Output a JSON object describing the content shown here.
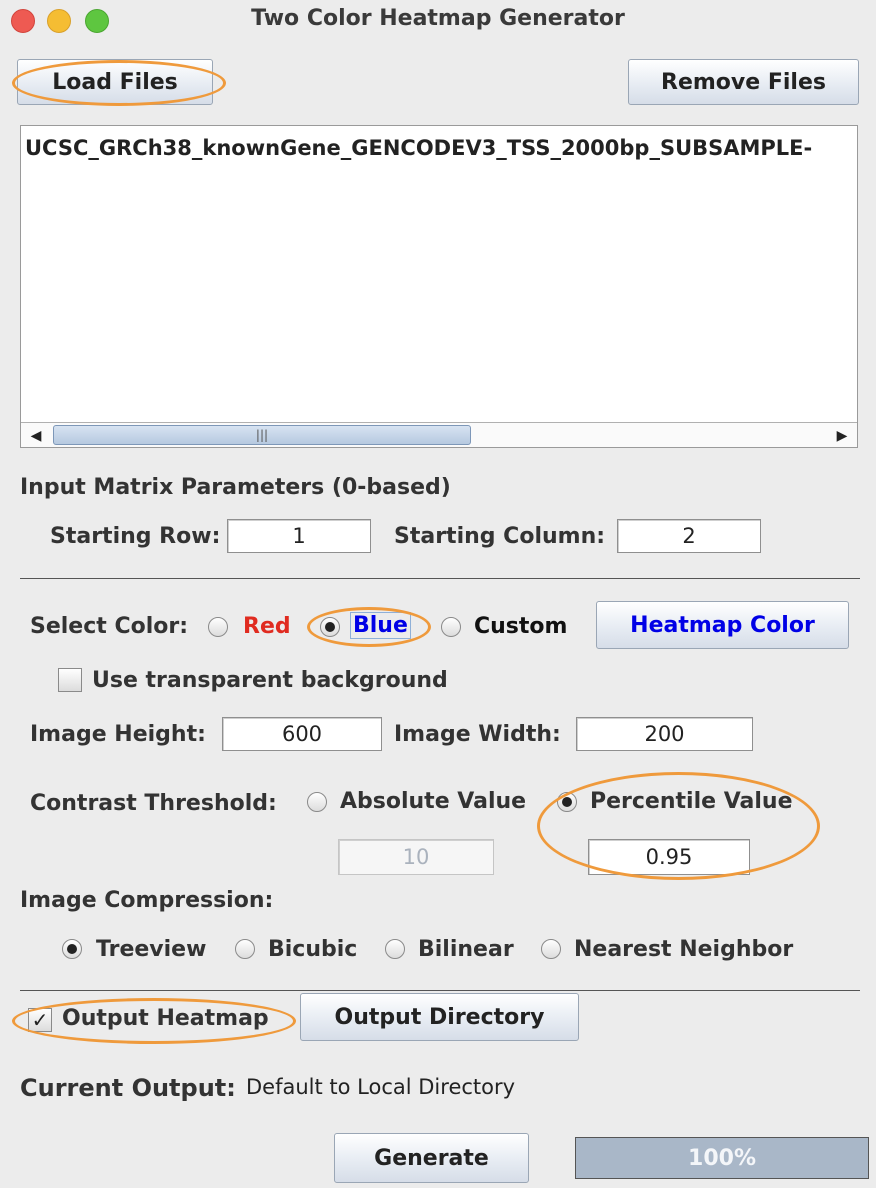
{
  "window": {
    "title": "Two Color Heatmap Generator"
  },
  "buttons": {
    "load_files": "Load Files",
    "remove_files": "Remove Files",
    "heatmap_color": "Heatmap Color",
    "output_directory": "Output Directory",
    "generate": "Generate"
  },
  "file_list": {
    "items": [
      "UCSC_GRCh38_knownGene_GENCODEV3_TSS_2000bp_SUBSAMPLE-"
    ]
  },
  "matrix": {
    "heading": "Input Matrix Parameters (0-based)",
    "starting_row_label": "Starting Row:",
    "starting_row_value": "1",
    "starting_column_label": "Starting Column:",
    "starting_column_value": "2"
  },
  "color": {
    "label": "Select Color:",
    "options": {
      "red": "Red",
      "blue": "Blue",
      "custom": "Custom"
    },
    "selected": "Blue",
    "red_color": "#e02b20",
    "blue_color": "#0000e6",
    "transparent_label": "Use transparent background",
    "transparent_checked": false
  },
  "image": {
    "height_label": "Image Height:",
    "height_value": "600",
    "width_label": "Image Width:",
    "width_value": "200"
  },
  "contrast": {
    "label": "Contrast Threshold:",
    "absolute_label": "Absolute Value",
    "percentile_label": "Percentile Value",
    "selected": "Percentile Value",
    "absolute_value": "10",
    "percentile_value": "0.95"
  },
  "compression": {
    "label": "Image Compression:",
    "options": [
      "Treeview",
      "Bicubic",
      "Bilinear",
      "Nearest Neighbor"
    ],
    "selected": "Treeview"
  },
  "output": {
    "heatmap_label": "Output Heatmap",
    "heatmap_checked": true,
    "current_output_label": "Current Output:",
    "current_output_value": "Default to Local Directory"
  },
  "progress": {
    "text": "100%",
    "value": 1.0
  },
  "highlight_color": "#ef9a3c"
}
